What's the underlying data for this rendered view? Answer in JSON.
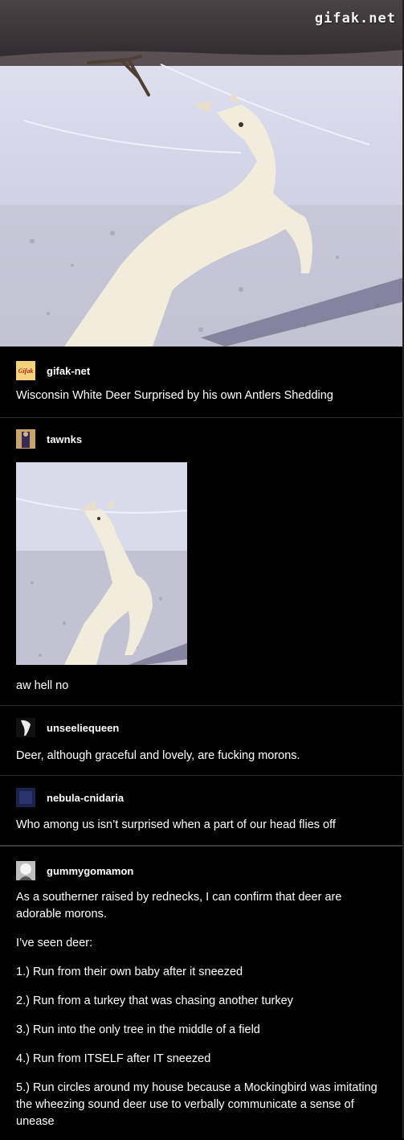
{
  "watermark": "gifak.net",
  "posts": [
    {
      "username": "gifak-net",
      "avatar_text": "Gifak",
      "text": "Wisconsin White Deer Surprised by his own Antlers Shedding"
    },
    {
      "username": "tawnks",
      "text": "aw hell no"
    },
    {
      "username": "unseeliequeen",
      "text": "Deer, although graceful and lovely, are fucking morons."
    },
    {
      "username": "nebula-cnidaria",
      "text": "Who among us isn’t surprised when a part of our head flies off"
    },
    {
      "username": "gummygomamon",
      "paragraphs": [
        "As a southerner raised by rednecks, I can confirm that deer are adorable morons.",
        "I’ve seen deer:",
        "1.) Run from their own baby after it sneezed",
        "2.) Run from a turkey that was chasing another turkey",
        "3.) Run into the only tree in the middle of a field",
        "4.) Run from ITSELF after IT sneezed",
        "5.) Run circles around my house because a Mockingbird was imitating the wheezing sound deer use to verbally communicate a sense of unease"
      ]
    }
  ],
  "colors": {
    "background": "#000000",
    "text": "#ffffff",
    "divider": "#2b2b2b",
    "snow": "#d8d9ea",
    "deer": "#f1ecdc"
  }
}
